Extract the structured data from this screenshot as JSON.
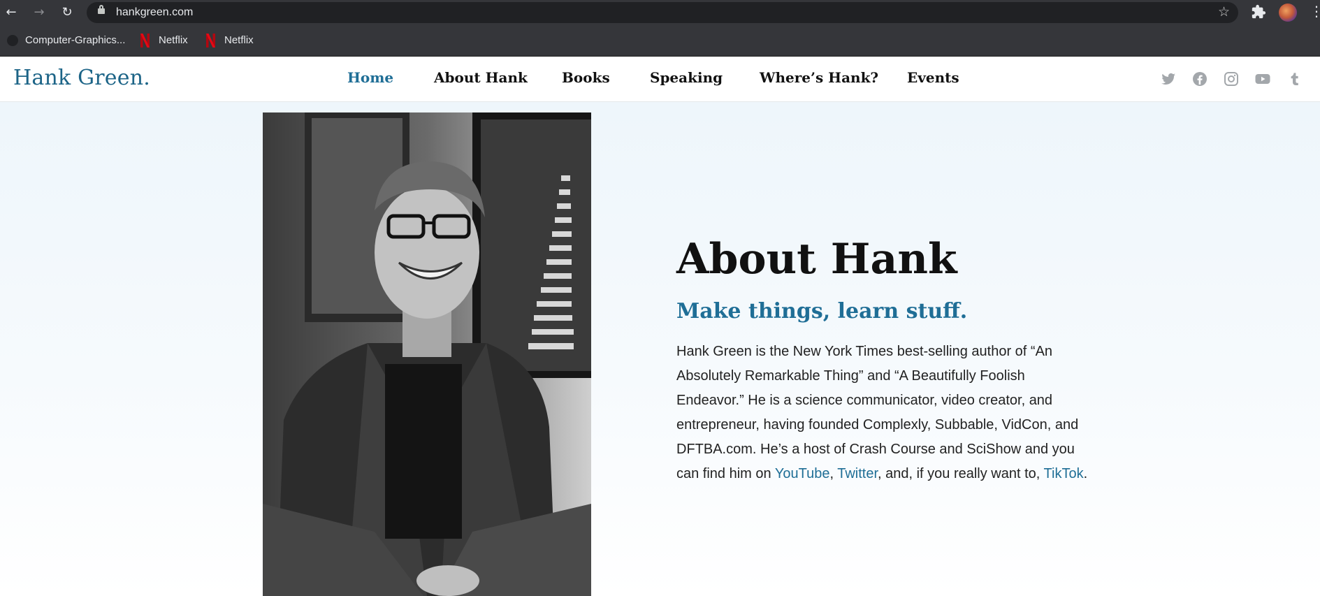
{
  "browser": {
    "url": "hankgreen.com",
    "bookmarks": [
      "Computer-Graphics...",
      "Netflix",
      "Netflix"
    ]
  },
  "site": {
    "logo": "Hank Green.",
    "nav": [
      {
        "label": "Home",
        "active": true
      },
      {
        "label": "About Hank",
        "active": false
      },
      {
        "label": "Books",
        "active": false
      },
      {
        "label": "Speaking",
        "active": false
      },
      {
        "label": "Where’s Hank?",
        "active": false
      },
      {
        "label": "Events",
        "active": false
      }
    ],
    "socials": [
      "twitter-icon",
      "facebook-icon",
      "instagram-icon",
      "youtube-icon",
      "tumblr-icon"
    ]
  },
  "about": {
    "title": "About Hank",
    "tagline": "Make things, learn stuff.",
    "bio_before_links": "Hank Green is the New York Times best-selling author of “An Absolutely Remarkable Thing” and “A Beautifully Foolish Endeavor.” He is a science communicator, video creator, and entrepreneur, having founded Complexly, Subbable, VidCon, and DFTBA.com. He’s a host of Crash Course and SciShow and you can find him on ",
    "link_youtube": "YouTube",
    "sep1": ", ",
    "link_twitter": "Twitter",
    "sep2": ", and, if you really want to, ",
    "link_tiktok": "TikTok",
    "end": "."
  },
  "colors": {
    "brand_blue": "#1f6e96",
    "chrome_dark": "#35363a"
  }
}
